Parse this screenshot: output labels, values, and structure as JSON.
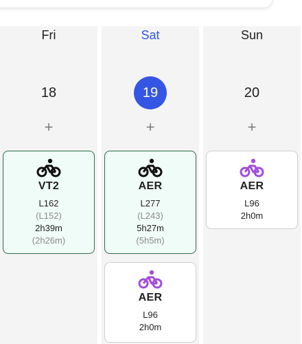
{
  "colors": {
    "accent": "#3556e4",
    "completed_border": "#2e6b4a",
    "completed_bg": "#f0fcf7",
    "icon_black": "#111111",
    "icon_purple": "#a24ddc"
  },
  "days": [
    {
      "name": "Fri",
      "date": "18",
      "add_label": "+",
      "workouts": [
        {
          "icon": "bike-icon",
          "code": "VT2",
          "load": "L162",
          "planned_load": "(L152)",
          "duration": "2h39m",
          "planned_duration": "(2h26m)"
        }
      ]
    },
    {
      "name": "Sat",
      "date": "19",
      "add_label": "+",
      "workouts": [
        {
          "icon": "bike-icon",
          "code": "AER",
          "load": "L277",
          "planned_load": "(L243)",
          "duration": "5h27m",
          "planned_duration": "(5h5m)"
        },
        {
          "icon": "bike-icon",
          "code": "AER",
          "load": "L96",
          "duration": "2h0m"
        }
      ]
    },
    {
      "name": "Sun",
      "date": "20",
      "add_label": "+",
      "workouts": [
        {
          "icon": "bike-icon",
          "code": "AER",
          "load": "L96",
          "duration": "2h0m"
        }
      ]
    }
  ]
}
